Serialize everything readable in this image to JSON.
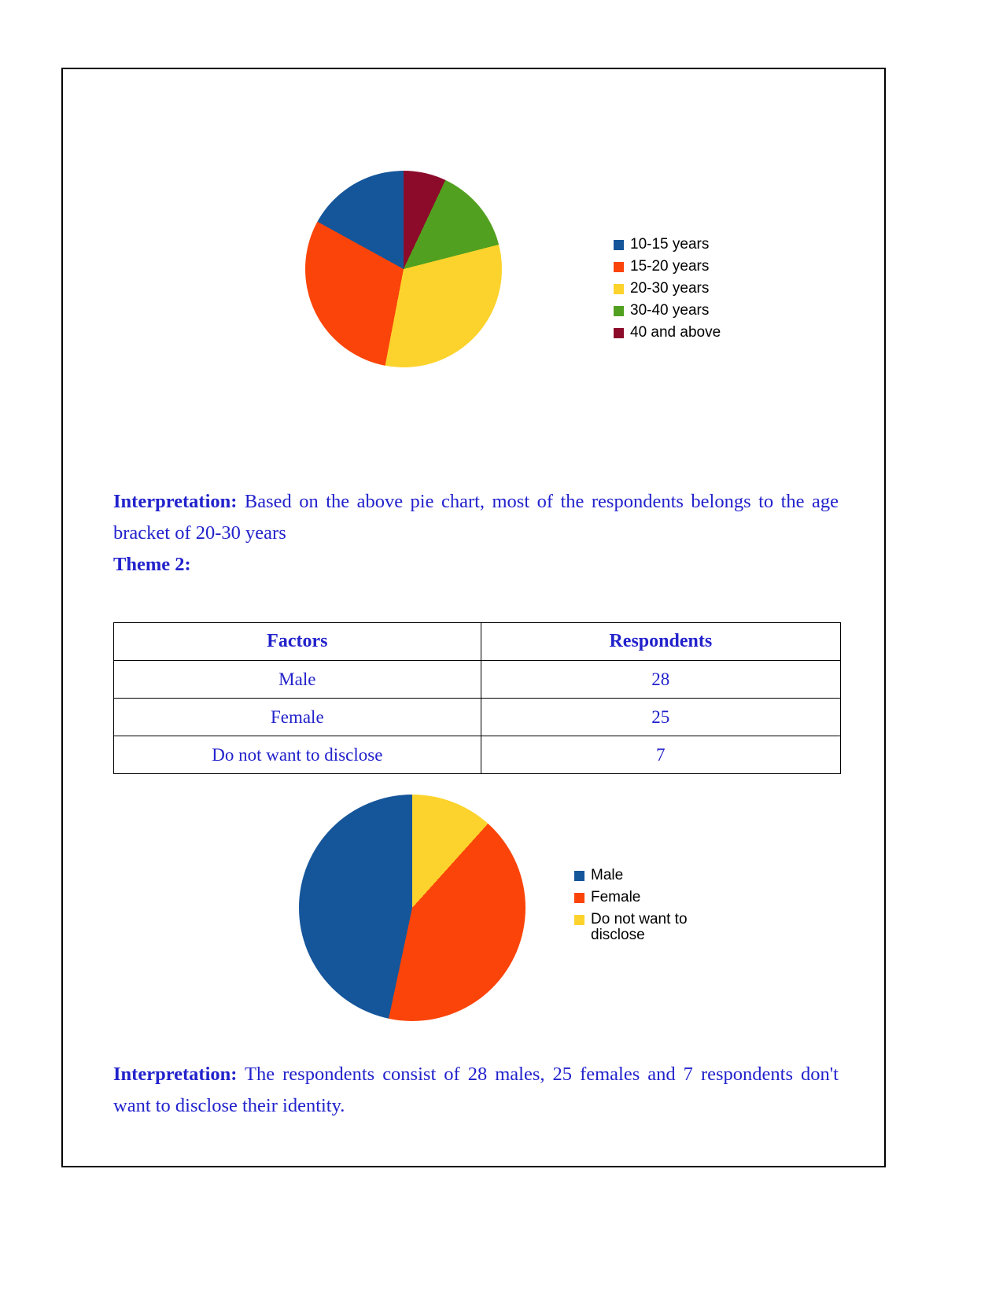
{
  "document": {
    "theme_heading": "Theme 2:",
    "interpretation_label": "Interpretation:",
    "interpretation_1_text": " Based on the above pie chart, most of the respondents belongs to the age bracket of 20-30 years",
    "interpretation_2_text": " The respondents consist of 28 males, 25 females and 7 respondents don't want to disclose their identity.",
    "text_color": "#2222cc",
    "border_color": "#000000"
  },
  "table": {
    "headers": [
      "Factors",
      "Respondents"
    ],
    "rows": [
      {
        "factor": "Male",
        "respondents": "28"
      },
      {
        "factor": "Female",
        "respondents": "25"
      },
      {
        "factor": "Do not want to disclose",
        "respondents": "7"
      }
    ]
  },
  "chart_data": [
    {
      "type": "pie",
      "title": "",
      "id": "age-pie-chart",
      "categories": [
        "10-15 years",
        "15-20 years",
        "20-30 years",
        "30-40 years",
        "40 and above"
      ],
      "values": [
        17,
        30,
        32,
        14,
        7
      ],
      "colors": [
        "#15569b",
        "#fb4409",
        "#fcd32c",
        "#52a01f",
        "#8c0b2a"
      ],
      "legend_position": "right",
      "legend_entries": [
        "10-15 years",
        "15-20 years",
        "20-30 years",
        "30-40 years",
        "40 and above"
      ],
      "start_angle_deg": 0,
      "direction": "counterclockwise"
    },
    {
      "type": "pie",
      "title": "",
      "id": "gender-pie-chart",
      "categories": [
        "Male",
        "Female",
        "Do not want to disclose"
      ],
      "values": [
        28,
        25,
        7
      ],
      "colors": [
        "#15569b",
        "#fb4409",
        "#fcd32c"
      ],
      "legend_position": "right",
      "legend_entries": [
        "Male",
        "Female",
        "Do not want to\ndisclose"
      ],
      "start_angle_deg": 0,
      "direction": "counterclockwise"
    }
  ]
}
